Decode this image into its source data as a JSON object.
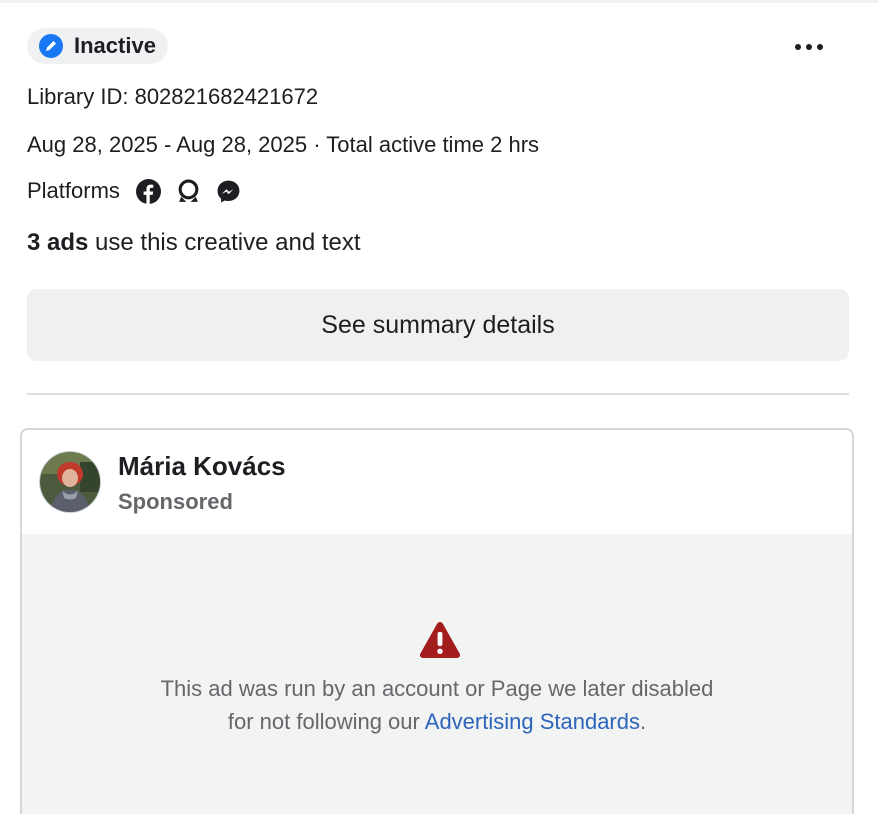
{
  "status": {
    "label": "Inactive",
    "icon": "pencil-circle-icon",
    "color": "#1877f2"
  },
  "more_menu": {
    "icon": "more-horizontal-icon"
  },
  "library_id": "Library ID: 802821682421672",
  "date_range": "Aug 28, 2025 - Aug 28, 2025 · Total active time 2 hrs",
  "platforms": {
    "label": "Platforms",
    "icons": [
      "facebook-icon",
      "audience-network-icon",
      "messenger-icon"
    ]
  },
  "ads_count": {
    "bold": "3 ads",
    "rest": " use this creative and text"
  },
  "summary_button": "See summary details",
  "ad": {
    "advertiser": "Mária Kovács",
    "sponsored": "Sponsored",
    "notice_text": "This ad was run by an account or Page we later disabled",
    "notice_text2": "for not following our ",
    "notice_link": "Advertising Standards",
    "notice_end": ".",
    "warning_color": "#a31d1d",
    "link_color": "#2d64bc"
  }
}
